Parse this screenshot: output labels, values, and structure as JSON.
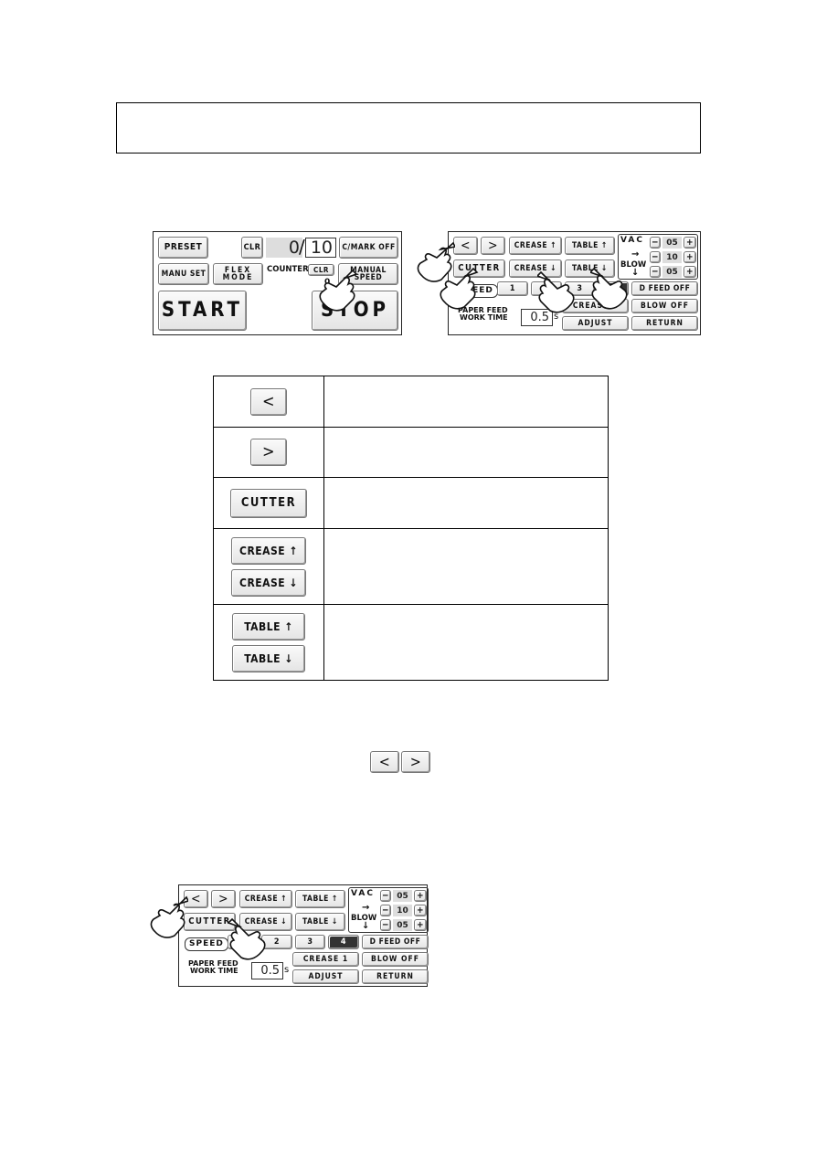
{
  "panel_a": {
    "preset": "PRESET",
    "clr": "CLR",
    "counter_value": "0",
    "counter_slash": "/",
    "counter_target": "10",
    "cmark": "C/MARK OFF",
    "manu_set": "MANU SET",
    "flex_mode": "FLEX\nMODE",
    "counter_label": "COUNTER",
    "counter_clr": "CLR",
    "counter_sub": "0",
    "manual_speed": "MANUAL\nSPEED",
    "start": "START",
    "stop": "STOP"
  },
  "panel_b": {
    "prev": "<",
    "next": ">",
    "crease_up": "CREASE ↑",
    "table_up": "TABLE ↑",
    "cutter": "CUTTER",
    "crease_down": "CREASE ↓",
    "table_down": "TABLE ↓",
    "vac": "VAC",
    "blow": "BLOW",
    "minus": "−",
    "plus": "+",
    "vac_value": "05",
    "blow_h_value": "10",
    "blow_v_value": "05",
    "speed": "SPEED",
    "speeds": [
      "1",
      "2",
      "3",
      "4"
    ],
    "selected_speed": "4",
    "d_feed": "D FEED OFF",
    "crease1": "CREASE 1",
    "blow_off": "BLOW OFF",
    "paper_feed": "PAPER FEED\nWORK TIME",
    "work_time": "0.5",
    "unit": "s",
    "adjust": "ADJUST",
    "return": "RETURN"
  },
  "table": {
    "rows": [
      {
        "buttons": [
          "<"
        ]
      },
      {
        "buttons": [
          ">"
        ]
      },
      {
        "buttons": [
          "CUTTER"
        ]
      },
      {
        "buttons": [
          "CREASE ↑",
          "CREASE ↓"
        ]
      },
      {
        "buttons": [
          "TABLE ↑",
          "TABLE ↓"
        ]
      }
    ]
  },
  "nav_buttons": [
    "<",
    ">"
  ]
}
